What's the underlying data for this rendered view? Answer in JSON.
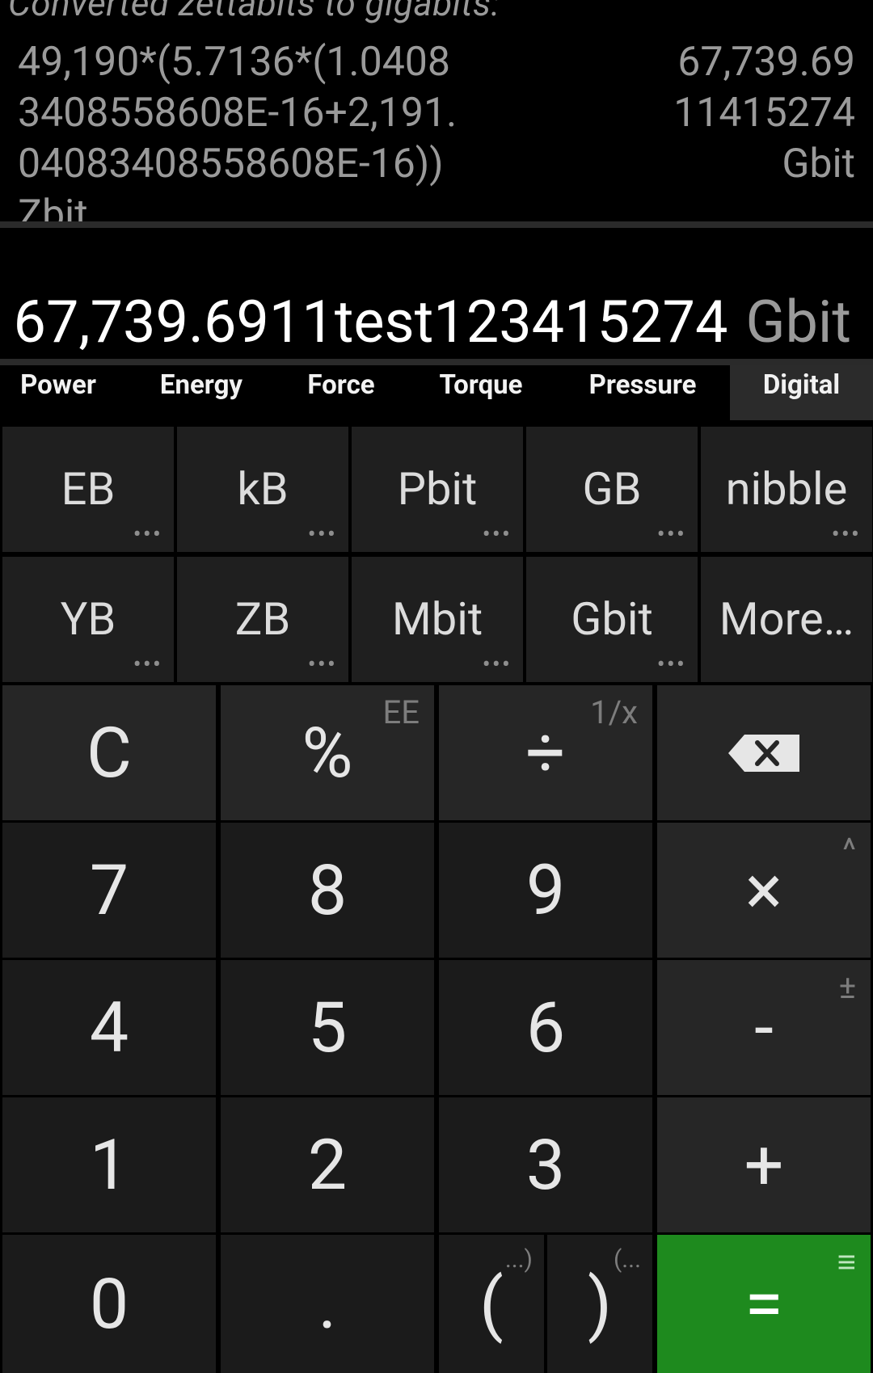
{
  "history": {
    "note": "Converted zettabits to gigabits:",
    "expression_lines": [
      "49,190*(5.7136*(1.0408",
      "3408558608E-16+2,191.",
      "04083408558608E-16))",
      "Zbit"
    ],
    "result_lines": [
      "67,739.69",
      "11415274",
      "Gbit"
    ]
  },
  "display": {
    "value": "67,739.6911test123415274",
    "unit": "Gbit"
  },
  "tabs": [
    "Power",
    "Energy",
    "Force",
    "Torque",
    "Pressure",
    "Digital"
  ],
  "active_tab": "Digital",
  "units": {
    "row1": [
      "EB",
      "kB",
      "Pbit",
      "GB",
      "nibble"
    ],
    "row2": [
      "YB",
      "ZB",
      "Mbit",
      "Gbit",
      "More…"
    ],
    "dots": "•••"
  },
  "keys": {
    "clear": "C",
    "percent": "%",
    "percent_alt": "EE",
    "divide": "÷",
    "divide_alt": "1/x",
    "seven": "7",
    "eight": "8",
    "nine": "9",
    "multiply": "×",
    "multiply_alt": "^",
    "four": "4",
    "five": "5",
    "six": "6",
    "minus": "-",
    "minus_alt": "±",
    "one": "1",
    "two": "2",
    "three": "3",
    "plus": "+",
    "zero": "0",
    "dot": ".",
    "paren_open": "(",
    "paren_open_alt": "...)",
    "paren_close": ")",
    "paren_close_alt": "(...",
    "equals": "=",
    "equals_alt": "≡"
  },
  "colors": {
    "equals_bg": "#1e8a1e",
    "background": "#000000",
    "key_bg": "#1b1b1b"
  }
}
